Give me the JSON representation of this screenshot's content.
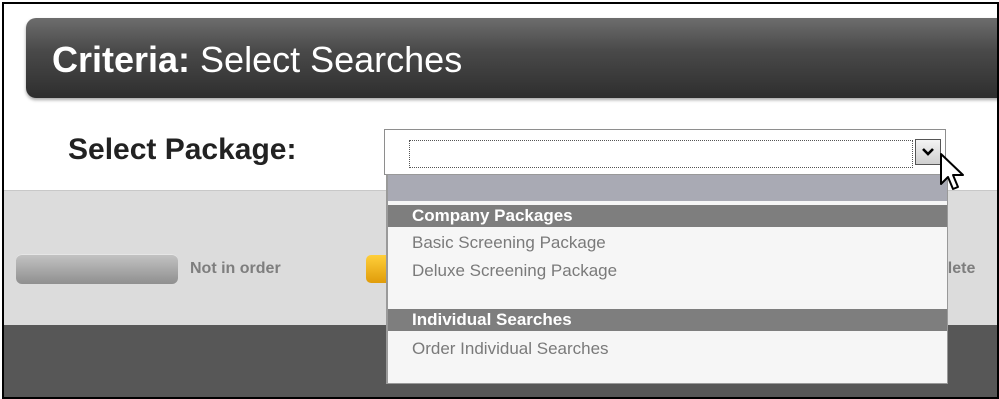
{
  "header": {
    "title_strong": "Criteria:",
    "title_rest": " Select Searches"
  },
  "form": {
    "select_package_label": "Select Package:",
    "select_value": "",
    "dropdown_arrow": "⌄"
  },
  "dropdown": {
    "groups": [
      {
        "label": "Company Packages",
        "options": [
          "Basic Screening Package",
          "Deluxe Screening Package"
        ]
      },
      {
        "label": "Individual Searches",
        "options": [
          "Order Individual Searches"
        ]
      }
    ]
  },
  "legend": {
    "not_in_order": "Not in order",
    "complete_partial": "plete"
  },
  "colors": {
    "header": "#4a4a4a",
    "dropdown_group": "#7e7e7e",
    "dropdown_selected": "#a9aab4",
    "status_orange": "#f0b020"
  }
}
